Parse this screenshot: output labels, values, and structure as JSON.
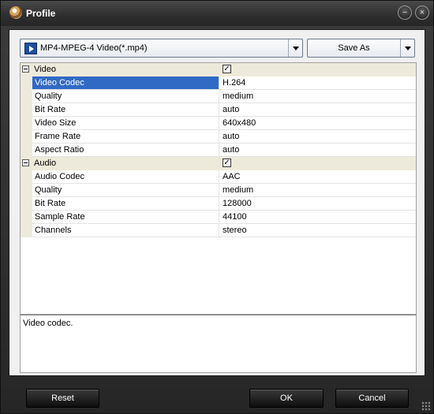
{
  "window": {
    "title": "Profile"
  },
  "format": {
    "selected": "MP4-MPEG-4 Video(*.mp4)"
  },
  "toolbar": {
    "save_as_label": "Save As"
  },
  "categories": [
    {
      "label": "Video",
      "checked": true,
      "props": [
        {
          "name": "Video Codec",
          "value": "H.264"
        },
        {
          "name": "Quality",
          "value": "medium"
        },
        {
          "name": "Bit Rate",
          "value": "auto"
        },
        {
          "name": "Video Size",
          "value": "640x480"
        },
        {
          "name": "Frame Rate",
          "value": "auto"
        },
        {
          "name": "Aspect Ratio",
          "value": "auto"
        }
      ]
    },
    {
      "label": "Audio",
      "checked": true,
      "props": [
        {
          "name": "Audio Codec",
          "value": "AAC"
        },
        {
          "name": "Quality",
          "value": "medium"
        },
        {
          "name": "Bit Rate",
          "value": "128000"
        },
        {
          "name": "Sample Rate",
          "value": "44100"
        },
        {
          "name": "Channels",
          "value": "stereo"
        }
      ]
    }
  ],
  "description": {
    "text": "Video codec."
  },
  "buttons": {
    "reset": "Reset",
    "ok": "OK",
    "cancel": "Cancel"
  }
}
